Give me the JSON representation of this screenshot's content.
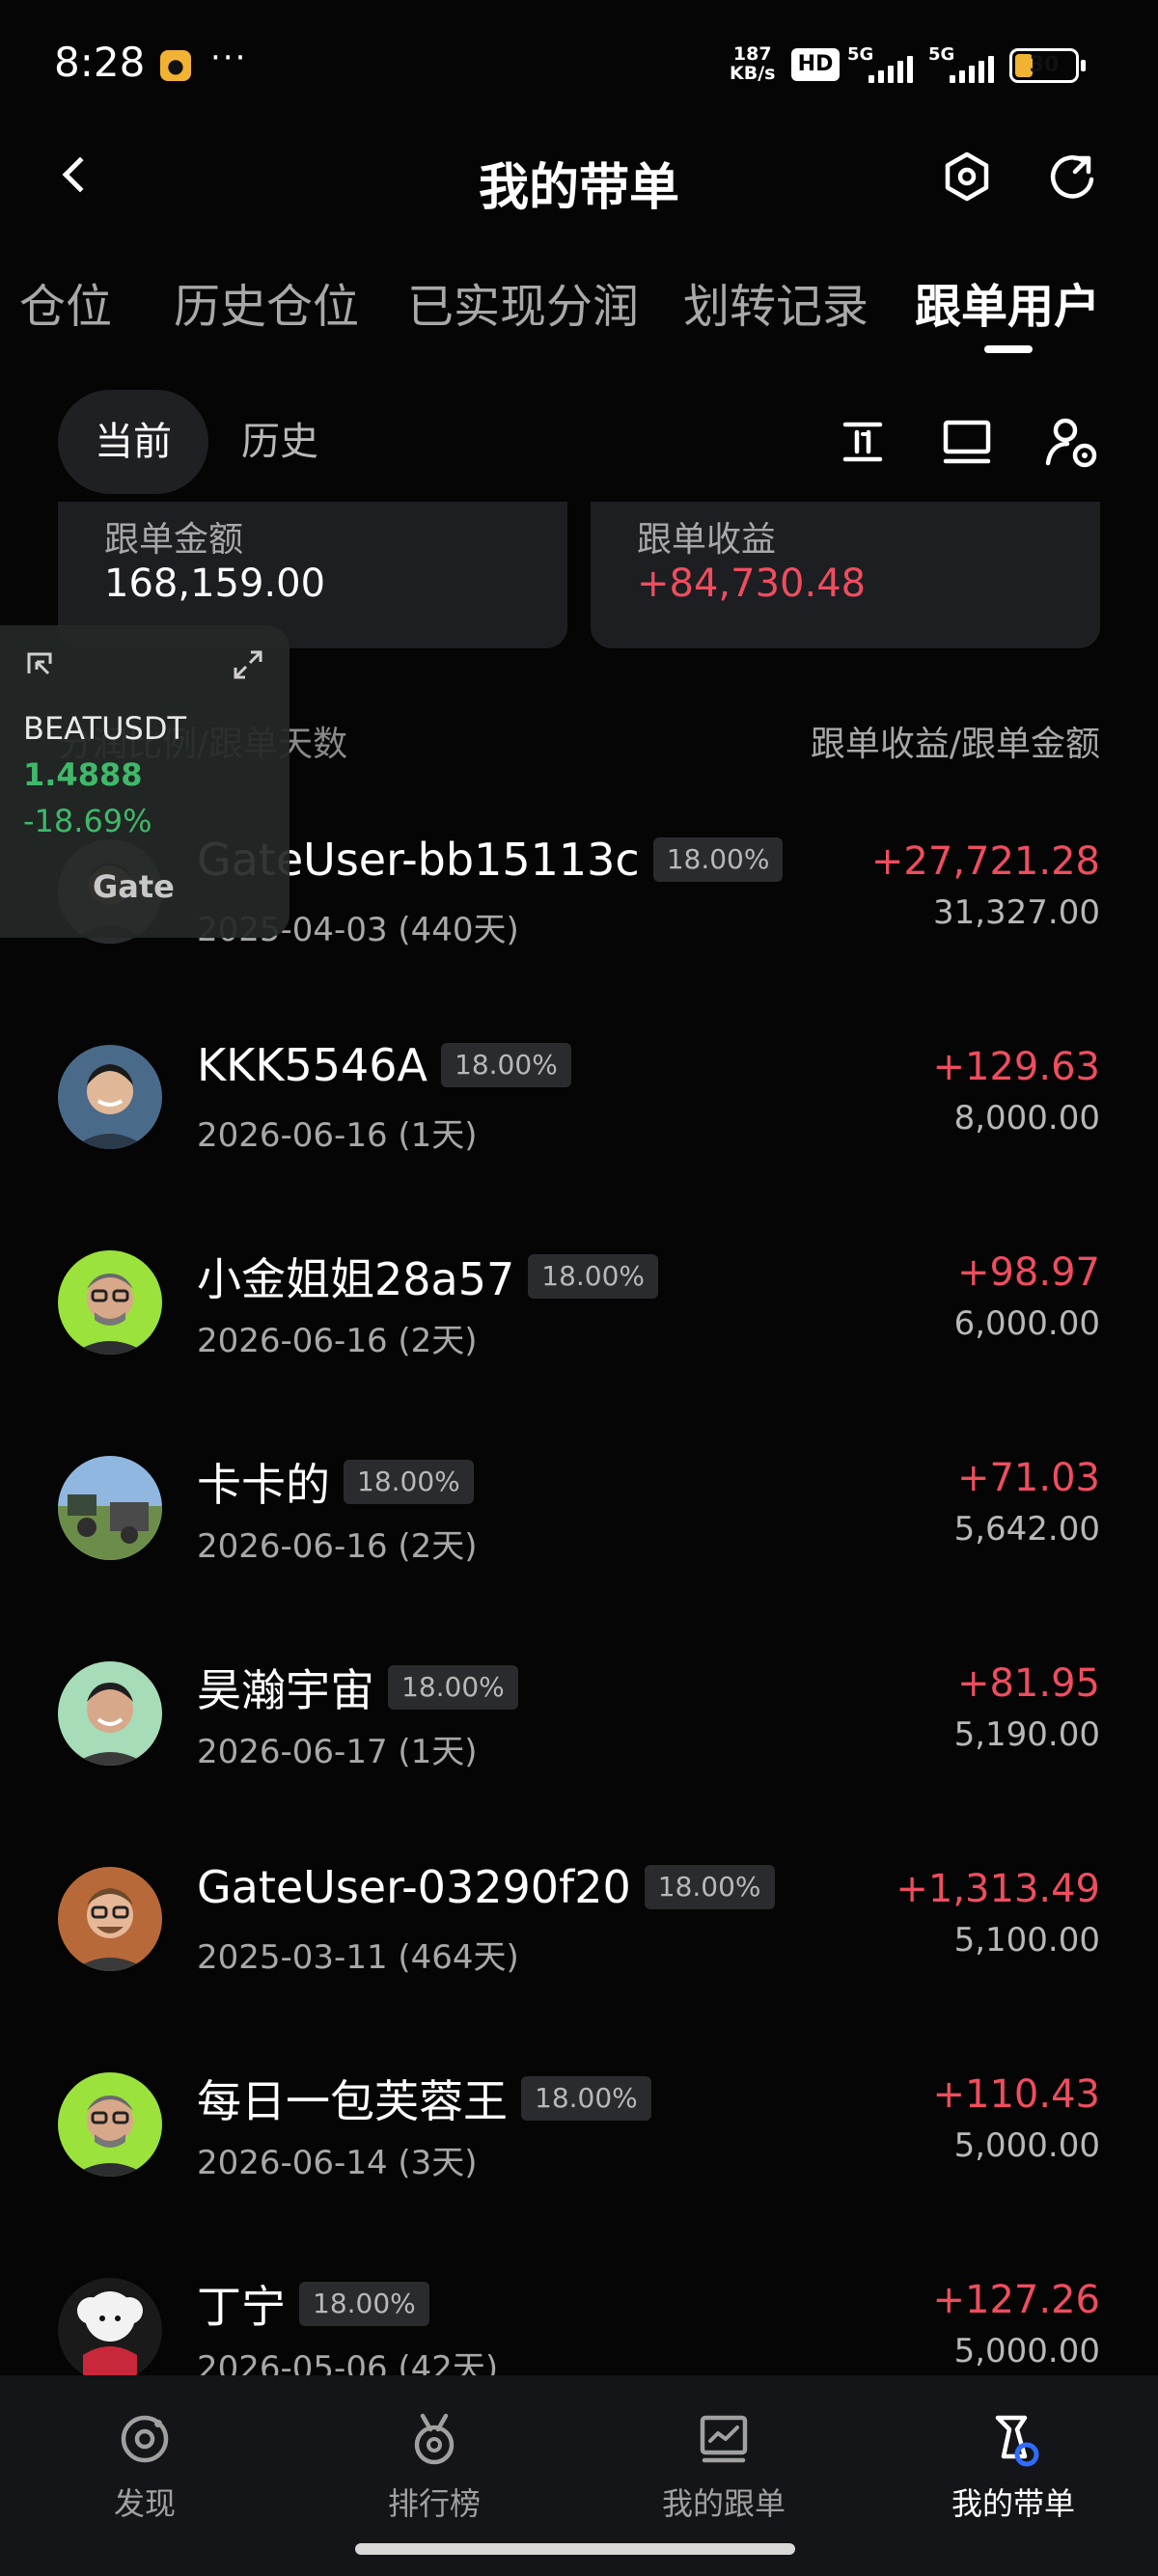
{
  "status_bar": {
    "time": "8:28",
    "dots": "···",
    "net_speed_value": "187",
    "net_speed_unit": "KB/s",
    "hd": "HD",
    "network_1": "5G",
    "network_2": "5G",
    "battery": "30",
    "battery_level": 0.3,
    "app_icon": "notification-app-icon"
  },
  "header": {
    "title": "我的带单",
    "back_icon": "chevron-left-icon",
    "settings_icon": "hexagon-settings-icon",
    "refresh_icon": "refresh-icon"
  },
  "tabs": [
    {
      "label": "仓位"
    },
    {
      "label": "历史仓位"
    },
    {
      "label": "已实现分润"
    },
    {
      "label": "划转记录"
    },
    {
      "label": "跟单用户",
      "active": true
    }
  ],
  "filter": {
    "current": "当前",
    "history": "历史",
    "icons": [
      "sort-icon",
      "display-icon",
      "user-settings-icon"
    ]
  },
  "summary": {
    "amount_label": "跟单金额",
    "amount_value": "168,159.00",
    "profit_label": "跟单收益",
    "profit_value": "+84,730.48"
  },
  "list_header": {
    "left": "分润比例/跟单天数",
    "right": "跟单收益/跟单金额"
  },
  "followers": [
    {
      "name": "GateUser-bb15113c",
      "ratio": "18.00%",
      "date": "2025-04-03 (440天)",
      "profit": "+27,721.28",
      "amount": "31,327.00"
    },
    {
      "name": "KKK5546A",
      "ratio": "18.00%",
      "date": "2026-06-16 (1天)",
      "profit": "+129.63",
      "amount": "8,000.00"
    },
    {
      "name": "小金姐姐28a57",
      "ratio": "18.00%",
      "date": "2026-06-16 (2天)",
      "profit": "+98.97",
      "amount": "6,000.00"
    },
    {
      "name": "卡卡的",
      "ratio": "18.00%",
      "date": "2026-06-16 (2天)",
      "profit": "+71.03",
      "amount": "5,642.00"
    },
    {
      "name": "昊瀚宇宙",
      "ratio": "18.00%",
      "date": "2026-06-17 (1天)",
      "profit": "+81.95",
      "amount": "5,190.00"
    },
    {
      "name": "GateUser-03290f20",
      "ratio": "18.00%",
      "date": "2025-03-11 (464天)",
      "profit": "+1,313.49",
      "amount": "5,100.00"
    },
    {
      "name": "每日一包芙蓉王",
      "ratio": "18.00%",
      "date": "2026-06-14 (3天)",
      "profit": "+110.43",
      "amount": "5,000.00"
    },
    {
      "name": "丁宁",
      "ratio": "18.00%",
      "date": "2026-05-06 (42天)",
      "profit": "+127.26",
      "amount": "5,000.00"
    }
  ],
  "floating_widget": {
    "symbol": "BEATUSDT",
    "price": "1.4888",
    "change": "-18.69%",
    "logo": "Gate"
  },
  "bottom_nav": [
    {
      "label": "发现",
      "icon": "discover-icon"
    },
    {
      "label": "排行榜",
      "icon": "medal-icon"
    },
    {
      "label": "我的跟单",
      "icon": "chart-window-icon"
    },
    {
      "label": "我的带单",
      "icon": "lead-trade-icon",
      "active": true
    }
  ],
  "colors": {
    "background": "#050505",
    "card": "#1d1e22",
    "profit_red": "#ef4d5f",
    "gain_green": "#3fb86a",
    "muted": "#a8a8a8"
  }
}
